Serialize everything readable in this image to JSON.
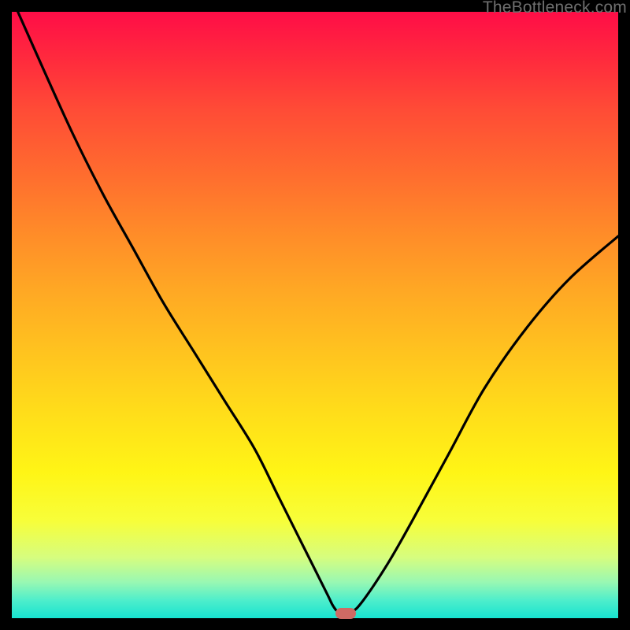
{
  "watermark": "TheBottleneck.com",
  "colors": {
    "curve": "#000000",
    "marker": "#cf6a64",
    "frame": "#000000"
  },
  "chart_data": {
    "type": "line",
    "title": "",
    "xlabel": "",
    "ylabel": "",
    "xlim": [
      0,
      100
    ],
    "ylim": [
      0,
      100
    ],
    "grid": false,
    "legend": false,
    "series": [
      {
        "name": "bottleneck-curve",
        "x": [
          1,
          5,
          10,
          15,
          20,
          25,
          30,
          35,
          40,
          44,
          48,
          52,
          53,
          54,
          56,
          58,
          62,
          66,
          72,
          78,
          85,
          92,
          100
        ],
        "y": [
          100,
          91,
          80,
          70,
          61,
          52,
          44,
          36,
          28,
          20,
          12,
          4,
          2,
          1,
          1,
          3,
          9,
          16,
          27,
          38,
          48,
          56,
          63
        ]
      }
    ],
    "marker": {
      "x": 55,
      "y": 0.8
    }
  }
}
